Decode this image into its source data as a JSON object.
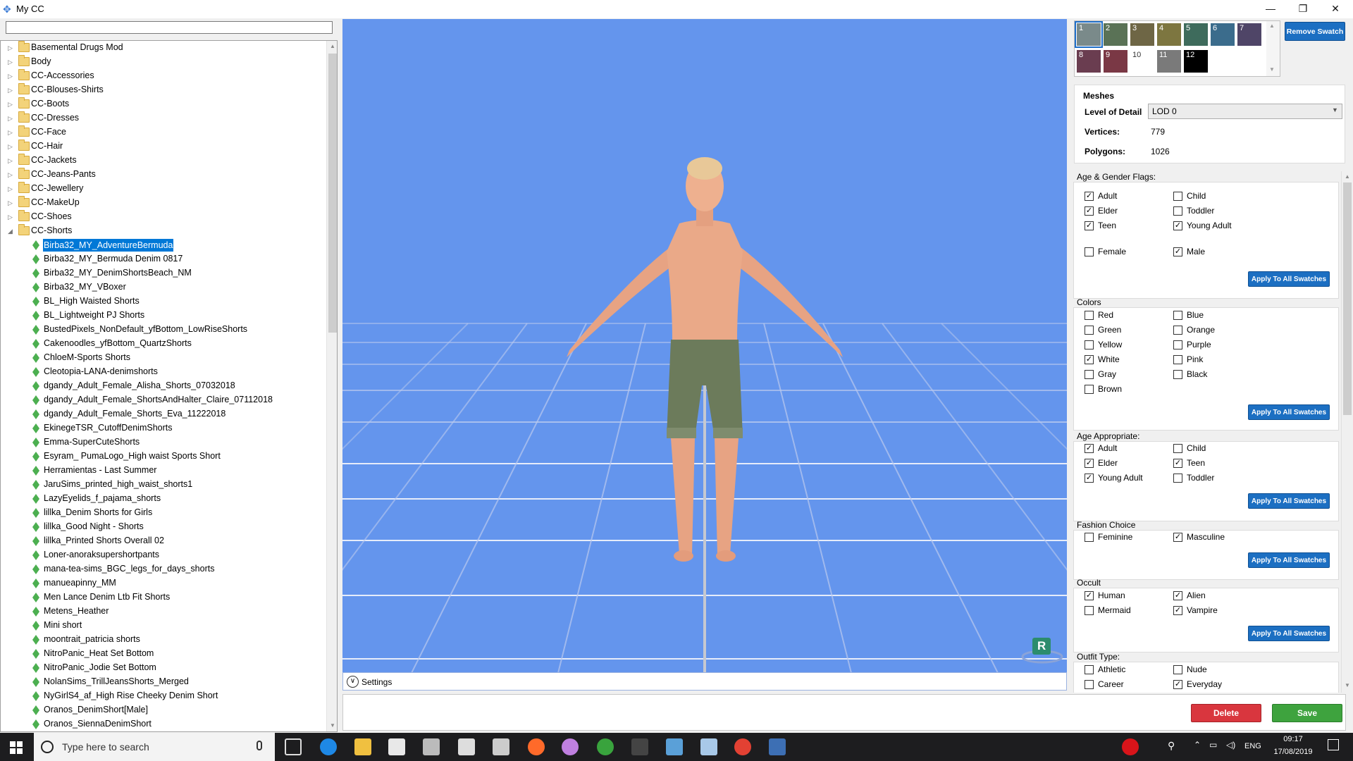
{
  "window": {
    "title": "My CC",
    "minimize": "—",
    "maximize": "❐",
    "close": "✕"
  },
  "tree": {
    "folders": [
      "Basemental Drugs Mod",
      "Body",
      "CC-Accessories",
      "CC-Blouses-Shirts",
      "CC-Boots",
      "CC-Dresses",
      "CC-Face",
      "CC-Hair",
      "CC-Jackets",
      "CC-Jeans-Pants",
      "CC-Jewellery",
      "CC-MakeUp",
      "CC-Shoes",
      "CC-Shorts"
    ],
    "expanded_folder": "CC-Shorts",
    "items": [
      "Birba32_MY_AdventureBermuda",
      "Birba32_MY_Bermuda Denim 0817",
      "Birba32_MY_DenimShortsBeach_NM",
      "Birba32_MY_VBoxer",
      "BL_High Waisted Shorts",
      "BL_Lightweight PJ Shorts",
      "BustedPixels_NonDefault_yfBottom_LowRiseShorts",
      "Cakenoodles_yfBottom_QuartzShorts",
      "ChloeM-Sports Shorts",
      "Cleotopia-LANA-denimshorts",
      "dgandy_Adult_Female_Alisha_Shorts_07032018",
      "dgandy_Adult_Female_ShortsAndHalter_Claire_07112018",
      "dgandy_Adult_Female_Shorts_Eva_11222018",
      "EkinegeTSR_CutoffDenimShorts",
      "Emma-SuperCuteShorts",
      "Esyram_ PumaLogo_High waist Sports Short",
      "Herramientas - Last Summer",
      "JaruSims_printed_high_waist_shorts1",
      "LazyEyelids_f_pajama_shorts",
      "lillka_Denim Shorts for Girls",
      "lillka_Good Night - Shorts",
      "lillka_Printed Shorts Overall 02",
      "Loner-anoraksupershortpants",
      "mana-tea-sims_BGC_legs_for_days_shorts",
      "manueapinny_MM",
      "Men Lance Denim Ltb Fit Shorts",
      "Metens_Heather",
      "Mini short",
      "moontrait_patricia shorts",
      "NitroPanic_Heat Set Bottom",
      "NitroPanic_Jodie Set Bottom",
      "NolanSims_TrillJeansShorts_Merged",
      "NyGirlS4_af_High Rise Cheeky Denim Short",
      "Oranos_DenimShort[Male]",
      "Oranos_SiennaDenimShort"
    ],
    "selected_index": 0
  },
  "viewport": {
    "settings_label": "Settings",
    "badge": "R",
    "background": "#6495ed"
  },
  "swatches": [
    {
      "n": "1",
      "color": "#7a8a8a"
    },
    {
      "n": "2",
      "color": "#5a7256"
    },
    {
      "n": "3",
      "color": "#6e6645"
    },
    {
      "n": "4",
      "color": "#7d7640"
    },
    {
      "n": "5",
      "color": "#3e6b5c"
    },
    {
      "n": "6",
      "color": "#3b6c8c"
    },
    {
      "n": "7",
      "color": "#4f4567"
    },
    {
      "n": "8",
      "color": "#6a3d50"
    },
    {
      "n": "9",
      "color": "#7a3845"
    },
    {
      "n": "10",
      "color": "#ffffff"
    },
    {
      "n": "11",
      "color": "#7a7a7a"
    },
    {
      "n": "12",
      "color": "#000000"
    }
  ],
  "remove_swatch": "Remove Swatch",
  "meshes": {
    "title": "Meshes",
    "lod_label": "Level of Detail",
    "lod_value": "LOD 0",
    "vertices_label": "Vertices:",
    "vertices": "779",
    "polygons_label": "Polygons:",
    "polygons": "1026"
  },
  "apply_label": "Apply To All Swatches",
  "groups": {
    "age_gender": {
      "title": "Age & Gender Flags:",
      "items": [
        {
          "label": "Adult",
          "checked": true
        },
        {
          "label": "Child",
          "checked": false
        },
        {
          "label": "Elder",
          "checked": true
        },
        {
          "label": "Toddler",
          "checked": false
        },
        {
          "label": "Teen",
          "checked": true
        },
        {
          "label": "Young Adult",
          "checked": true
        },
        {
          "label": "Female",
          "checked": false
        },
        {
          "label": "Male",
          "checked": true
        }
      ]
    },
    "colors": {
      "title": "Colors",
      "items": [
        {
          "label": "Red",
          "checked": false
        },
        {
          "label": "Blue",
          "checked": false
        },
        {
          "label": "Green",
          "checked": false
        },
        {
          "label": "Orange",
          "checked": false
        },
        {
          "label": "Yellow",
          "checked": false
        },
        {
          "label": "Purple",
          "checked": false
        },
        {
          "label": "White",
          "checked": true
        },
        {
          "label": "Pink",
          "checked": false
        },
        {
          "label": "Gray",
          "checked": false
        },
        {
          "label": "Black",
          "checked": false
        },
        {
          "label": "Brown",
          "checked": false
        }
      ]
    },
    "age_appropriate": {
      "title": "Age Appropriate:",
      "items": [
        {
          "label": "Adult",
          "checked": true
        },
        {
          "label": "Child",
          "checked": false
        },
        {
          "label": "Elder",
          "checked": true
        },
        {
          "label": "Teen",
          "checked": true
        },
        {
          "label": "Young Adult",
          "checked": true
        },
        {
          "label": "Toddler",
          "checked": false
        }
      ]
    },
    "fashion": {
      "title": "Fashion Choice",
      "items": [
        {
          "label": "Feminine",
          "checked": false
        },
        {
          "label": "Masculine",
          "checked": true
        }
      ]
    },
    "occult": {
      "title": "Occult",
      "items": [
        {
          "label": "Human",
          "checked": true
        },
        {
          "label": "Alien",
          "checked": true
        },
        {
          "label": "Mermaid",
          "checked": false
        },
        {
          "label": "Vampire",
          "checked": true
        }
      ]
    },
    "outfit": {
      "title": "Outfit Type:",
      "items": [
        {
          "label": "Athletic",
          "checked": false
        },
        {
          "label": "Nude",
          "checked": false
        },
        {
          "label": "Career",
          "checked": false
        },
        {
          "label": "Everyday",
          "checked": true
        }
      ]
    }
  },
  "actions": {
    "delete": "Delete",
    "save": "Save"
  },
  "taskbar": {
    "search_placeholder": "Type here to search",
    "lang": "ENG",
    "time": "09:17",
    "date": "17/08/2019"
  }
}
